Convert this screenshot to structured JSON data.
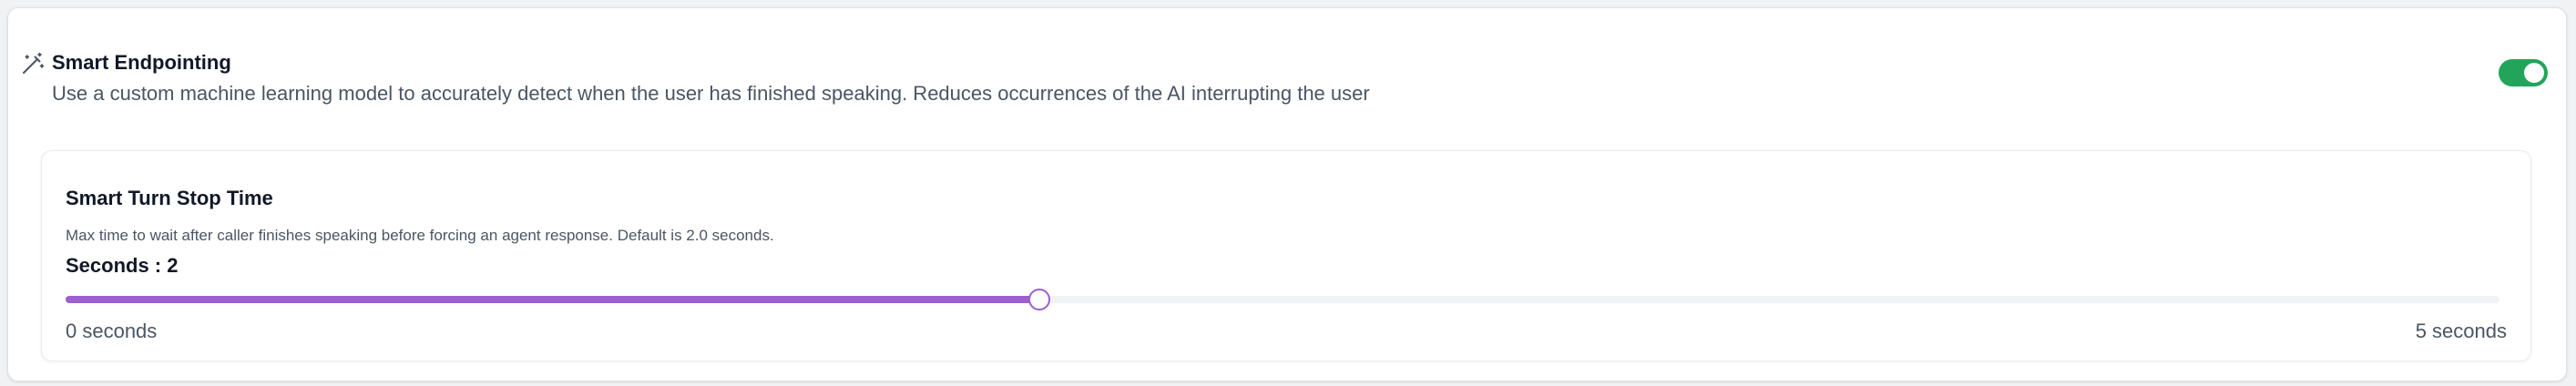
{
  "smart_endpointing": {
    "icon": "magic-wand-icon",
    "title": "Smart Endpointing",
    "description": "Use a custom machine learning model to accurately detect when the user has finished speaking. Reduces occurrences of the AI interrupting the user",
    "enabled": true
  },
  "smart_turn_stop_time": {
    "title": "Smart Turn Stop Time",
    "description": "Max time to wait after caller finishes speaking before forcing an agent response. Default is 2.0 seconds.",
    "seconds_label": "Seconds : 2",
    "slider": {
      "min": 0,
      "max": 5,
      "value": 2,
      "min_label": "0 seconds",
      "max_label": "5 seconds"
    }
  },
  "colors": {
    "toggle_on": "#22a55a",
    "slider_fill": "#9b5fd0",
    "slider_track": "#f1f2f6"
  }
}
